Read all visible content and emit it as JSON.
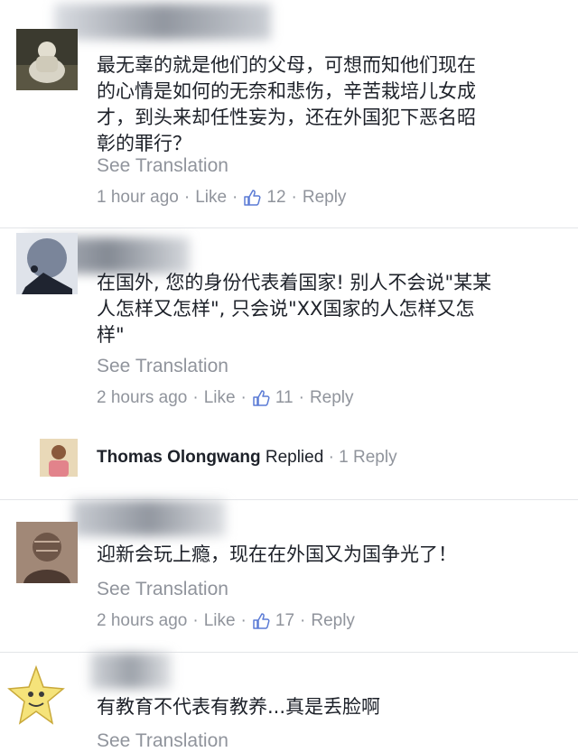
{
  "comments": [
    {
      "name_visible": "ng g ng",
      "text": "最无辜的就是他们的父母，可想而知他们现在的心情是如何的无奈和悲伤，辛苦栽培儿女成才，到头来却任性妄为，还在外国犯下恶名昭彰的罪行？",
      "lines": [
        "最无辜的就是他们的父母，可想而知他们现在",
        "的心情是如何的无奈和悲伤，辛苦栽培儿女成",
        "才，到头来却任性妄为，还在外国犯下恶名昭",
        "彰的罪行？"
      ],
      "see_translation": "See Translation",
      "time": "1 hour ago",
      "like": "Like",
      "likes": "12",
      "reply": "Reply",
      "avatar_icon": "buddha-statue-avatar"
    },
    {
      "name_visible": "t SG",
      "lines": [
        "在国外, 您的身份代表着国家! 别人不会说\"某某",
        "人怎样又怎样\", 只会说\"XX国家的人怎样又怎",
        "样\""
      ],
      "see_translation": "See Translation",
      "time": "2 hours ago",
      "like": "Like",
      "likes": "11",
      "reply": "Reply",
      "avatar_icon": "silhouette-avatar"
    },
    {
      "name_visible": "a Chow",
      "lines": [
        "迎新会玩上瘾，现在在外国又为国争光了！"
      ],
      "see_translation": "See Translation",
      "time": "2 hours ago",
      "like": "Like",
      "likes": "17",
      "reply": "Reply",
      "avatar_icon": "sketch-portrait-avatar"
    },
    {
      "name_visible": "",
      "lines": [
        "有教育不代表有教养...真是丢脸啊"
      ],
      "see_translation": "See Translation",
      "avatar_icon": "star-face-avatar"
    }
  ],
  "reply_summary": {
    "name": "Thomas Olongwang",
    "action": "Replied",
    "count": "1 Reply"
  },
  "colors": {
    "text": "#1d2129",
    "meta": "#90949c",
    "divider": "#e3e5e8"
  }
}
